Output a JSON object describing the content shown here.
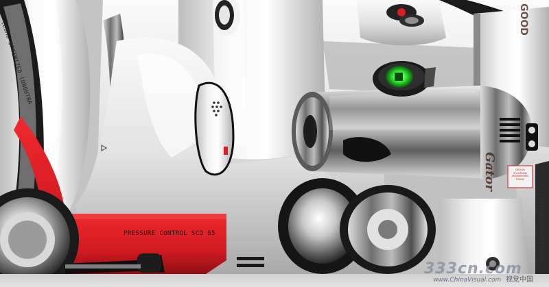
{
  "texts": {
    "tire_sidewall": "(DOME OPTIMIZED (UNOUTRA",
    "pressure_control": "PRESSURE CONTROL SCD 65",
    "sticker_lines": [
      "DESIGN",
      "SOLUTIONS",
      "ENGINEERING",
      "PHASE"
    ],
    "brand_right": "Gator",
    "top_brand": "GOOD",
    "copyright": "© WWW.DANIELSIMON.NET"
  },
  "watermark": {
    "number": "333cn.com",
    "site": "www.ChinaVisual.com",
    "name": "视觉中国"
  },
  "colors": {
    "body_white": "#e8e8e8",
    "accent_red": "#d81d23",
    "chrome": "#9a9a9a",
    "dark": "#111111",
    "indicator_green": "#3cff3c"
  },
  "icons": {
    "shower_dots_panel": "dot-grid-icon",
    "triangle_marker": "triangle-icon",
    "vent_grille": "grille-icon"
  }
}
